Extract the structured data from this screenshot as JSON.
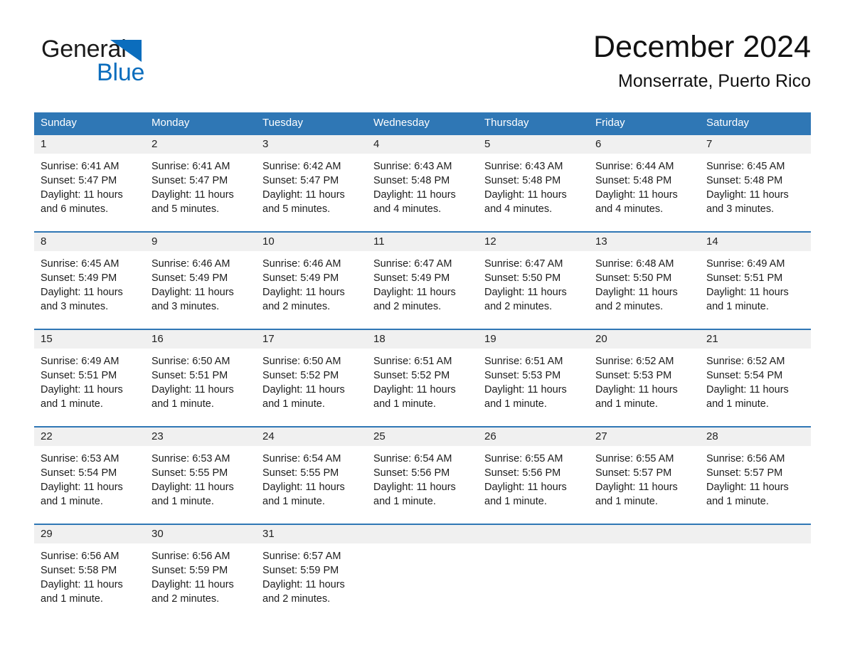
{
  "brand": {
    "name_part1": "General",
    "name_part2": "Blue",
    "triangle_icon": "brand-triangle-icon",
    "accent_color": "#0b6dbd"
  },
  "header": {
    "title": "December 2024",
    "subtitle": "Monserrate, Puerto Rico"
  },
  "colors": {
    "header_blue": "#2f77b5",
    "date_band_gray": "#f0f0f0",
    "text": "#1c1c1c",
    "brand_blue": "#0b6dbd"
  },
  "calendar": {
    "day_headers": [
      "Sunday",
      "Monday",
      "Tuesday",
      "Wednesday",
      "Thursday",
      "Friday",
      "Saturday"
    ],
    "weeks": [
      {
        "days": [
          {
            "date": "1",
            "sunrise": "Sunrise: 6:41 AM",
            "sunset": "Sunset: 5:47 PM",
            "daylight": "Daylight: 11 hours and 6 minutes."
          },
          {
            "date": "2",
            "sunrise": "Sunrise: 6:41 AM",
            "sunset": "Sunset: 5:47 PM",
            "daylight": "Daylight: 11 hours and 5 minutes."
          },
          {
            "date": "3",
            "sunrise": "Sunrise: 6:42 AM",
            "sunset": "Sunset: 5:47 PM",
            "daylight": "Daylight: 11 hours and 5 minutes."
          },
          {
            "date": "4",
            "sunrise": "Sunrise: 6:43 AM",
            "sunset": "Sunset: 5:48 PM",
            "daylight": "Daylight: 11 hours and 4 minutes."
          },
          {
            "date": "5",
            "sunrise": "Sunrise: 6:43 AM",
            "sunset": "Sunset: 5:48 PM",
            "daylight": "Daylight: 11 hours and 4 minutes."
          },
          {
            "date": "6",
            "sunrise": "Sunrise: 6:44 AM",
            "sunset": "Sunset: 5:48 PM",
            "daylight": "Daylight: 11 hours and 4 minutes."
          },
          {
            "date": "7",
            "sunrise": "Sunrise: 6:45 AM",
            "sunset": "Sunset: 5:48 PM",
            "daylight": "Daylight: 11 hours and 3 minutes."
          }
        ]
      },
      {
        "days": [
          {
            "date": "8",
            "sunrise": "Sunrise: 6:45 AM",
            "sunset": "Sunset: 5:49 PM",
            "daylight": "Daylight: 11 hours and 3 minutes."
          },
          {
            "date": "9",
            "sunrise": "Sunrise: 6:46 AM",
            "sunset": "Sunset: 5:49 PM",
            "daylight": "Daylight: 11 hours and 3 minutes."
          },
          {
            "date": "10",
            "sunrise": "Sunrise: 6:46 AM",
            "sunset": "Sunset: 5:49 PM",
            "daylight": "Daylight: 11 hours and 2 minutes."
          },
          {
            "date": "11",
            "sunrise": "Sunrise: 6:47 AM",
            "sunset": "Sunset: 5:49 PM",
            "daylight": "Daylight: 11 hours and 2 minutes."
          },
          {
            "date": "12",
            "sunrise": "Sunrise: 6:47 AM",
            "sunset": "Sunset: 5:50 PM",
            "daylight": "Daylight: 11 hours and 2 minutes."
          },
          {
            "date": "13",
            "sunrise": "Sunrise: 6:48 AM",
            "sunset": "Sunset: 5:50 PM",
            "daylight": "Daylight: 11 hours and 2 minutes."
          },
          {
            "date": "14",
            "sunrise": "Sunrise: 6:49 AM",
            "sunset": "Sunset: 5:51 PM",
            "daylight": "Daylight: 11 hours and 1 minute."
          }
        ]
      },
      {
        "days": [
          {
            "date": "15",
            "sunrise": "Sunrise: 6:49 AM",
            "sunset": "Sunset: 5:51 PM",
            "daylight": "Daylight: 11 hours and 1 minute."
          },
          {
            "date": "16",
            "sunrise": "Sunrise: 6:50 AM",
            "sunset": "Sunset: 5:51 PM",
            "daylight": "Daylight: 11 hours and 1 minute."
          },
          {
            "date": "17",
            "sunrise": "Sunrise: 6:50 AM",
            "sunset": "Sunset: 5:52 PM",
            "daylight": "Daylight: 11 hours and 1 minute."
          },
          {
            "date": "18",
            "sunrise": "Sunrise: 6:51 AM",
            "sunset": "Sunset: 5:52 PM",
            "daylight": "Daylight: 11 hours and 1 minute."
          },
          {
            "date": "19",
            "sunrise": "Sunrise: 6:51 AM",
            "sunset": "Sunset: 5:53 PM",
            "daylight": "Daylight: 11 hours and 1 minute."
          },
          {
            "date": "20",
            "sunrise": "Sunrise: 6:52 AM",
            "sunset": "Sunset: 5:53 PM",
            "daylight": "Daylight: 11 hours and 1 minute."
          },
          {
            "date": "21",
            "sunrise": "Sunrise: 6:52 AM",
            "sunset": "Sunset: 5:54 PM",
            "daylight": "Daylight: 11 hours and 1 minute."
          }
        ]
      },
      {
        "days": [
          {
            "date": "22",
            "sunrise": "Sunrise: 6:53 AM",
            "sunset": "Sunset: 5:54 PM",
            "daylight": "Daylight: 11 hours and 1 minute."
          },
          {
            "date": "23",
            "sunrise": "Sunrise: 6:53 AM",
            "sunset": "Sunset: 5:55 PM",
            "daylight": "Daylight: 11 hours and 1 minute."
          },
          {
            "date": "24",
            "sunrise": "Sunrise: 6:54 AM",
            "sunset": "Sunset: 5:55 PM",
            "daylight": "Daylight: 11 hours and 1 minute."
          },
          {
            "date": "25",
            "sunrise": "Sunrise: 6:54 AM",
            "sunset": "Sunset: 5:56 PM",
            "daylight": "Daylight: 11 hours and 1 minute."
          },
          {
            "date": "26",
            "sunrise": "Sunrise: 6:55 AM",
            "sunset": "Sunset: 5:56 PM",
            "daylight": "Daylight: 11 hours and 1 minute."
          },
          {
            "date": "27",
            "sunrise": "Sunrise: 6:55 AM",
            "sunset": "Sunset: 5:57 PM",
            "daylight": "Daylight: 11 hours and 1 minute."
          },
          {
            "date": "28",
            "sunrise": "Sunrise: 6:56 AM",
            "sunset": "Sunset: 5:57 PM",
            "daylight": "Daylight: 11 hours and 1 minute."
          }
        ]
      },
      {
        "days": [
          {
            "date": "29",
            "sunrise": "Sunrise: 6:56 AM",
            "sunset": "Sunset: 5:58 PM",
            "daylight": "Daylight: 11 hours and 1 minute."
          },
          {
            "date": "30",
            "sunrise": "Sunrise: 6:56 AM",
            "sunset": "Sunset: 5:59 PM",
            "daylight": "Daylight: 11 hours and 2 minutes."
          },
          {
            "date": "31",
            "sunrise": "Sunrise: 6:57 AM",
            "sunset": "Sunset: 5:59 PM",
            "daylight": "Daylight: 11 hours and 2 minutes."
          },
          {
            "date": "",
            "sunrise": "",
            "sunset": "",
            "daylight": ""
          },
          {
            "date": "",
            "sunrise": "",
            "sunset": "",
            "daylight": ""
          },
          {
            "date": "",
            "sunrise": "",
            "sunset": "",
            "daylight": ""
          },
          {
            "date": "",
            "sunrise": "",
            "sunset": "",
            "daylight": ""
          }
        ]
      }
    ]
  }
}
